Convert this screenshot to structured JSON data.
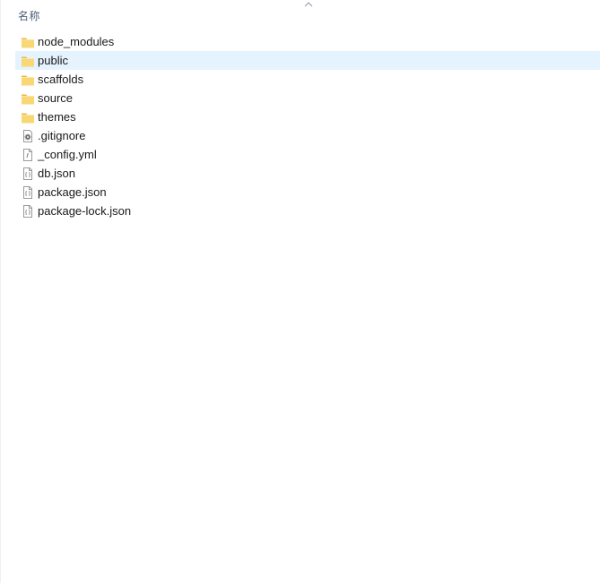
{
  "header": {
    "column_name": "名称",
    "sort_indicator": "sort-ascending-arrow"
  },
  "files": [
    {
      "name": "node_modules",
      "type": "folder",
      "icon": "folder-icon",
      "selected": false
    },
    {
      "name": "public",
      "type": "folder",
      "icon": "folder-icon",
      "selected": true
    },
    {
      "name": "scaffolds",
      "type": "folder",
      "icon": "folder-icon",
      "selected": false
    },
    {
      "name": "source",
      "type": "folder",
      "icon": "folder-icon",
      "selected": false
    },
    {
      "name": "themes",
      "type": "folder",
      "icon": "folder-icon",
      "selected": false
    },
    {
      "name": ".gitignore",
      "type": "file",
      "icon": "gear-file-icon",
      "selected": false
    },
    {
      "name": "_config.yml",
      "type": "file",
      "icon": "text-file-icon",
      "selected": false
    },
    {
      "name": "db.json",
      "type": "file",
      "icon": "json-file-icon",
      "selected": false
    },
    {
      "name": "package.json",
      "type": "file",
      "icon": "json-file-icon",
      "selected": false
    },
    {
      "name": "package-lock.json",
      "type": "file",
      "icon": "json-file-icon",
      "selected": false
    }
  ],
  "colors": {
    "selection": "#e5f3ff",
    "folder": "#f8d775",
    "header_text": "#4c607a"
  }
}
